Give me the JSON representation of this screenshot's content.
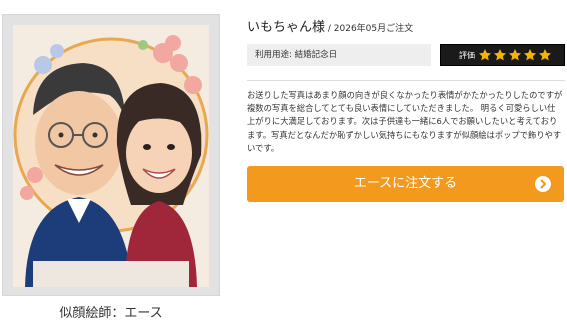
{
  "photo": {
    "subject": "caricature-portrait-of-couple"
  },
  "artist_caption": "似顔絵師：エース",
  "review": {
    "customer_name": "いもちゃん様",
    "order_date": " / 2026年05月ご注文",
    "usage": "利用用途: 結婚記念日",
    "rating_label": "評価",
    "rating": 5,
    "rating_max": 5,
    "body": "お送りした写真はあまり顔の向きが良くなかったり表情がかたかったりしたのですが複数の写真を総合してとても良い表情にしていただきました。 明るく可愛らしい仕上がりに大満足しております。次は子供達も一緒に6人でお願いしたいと考えております。写真だとなんだか恥ずかしい気持ちにもなりますが似顔絵はポップで飾りやすいです。"
  },
  "order_button": {
    "label": "エースに注文する",
    "icon": "chevron-right-icon"
  },
  "colors": {
    "accent": "#f39a1e",
    "star": "#f5b400",
    "rating_bg": "#1a1a1a"
  }
}
